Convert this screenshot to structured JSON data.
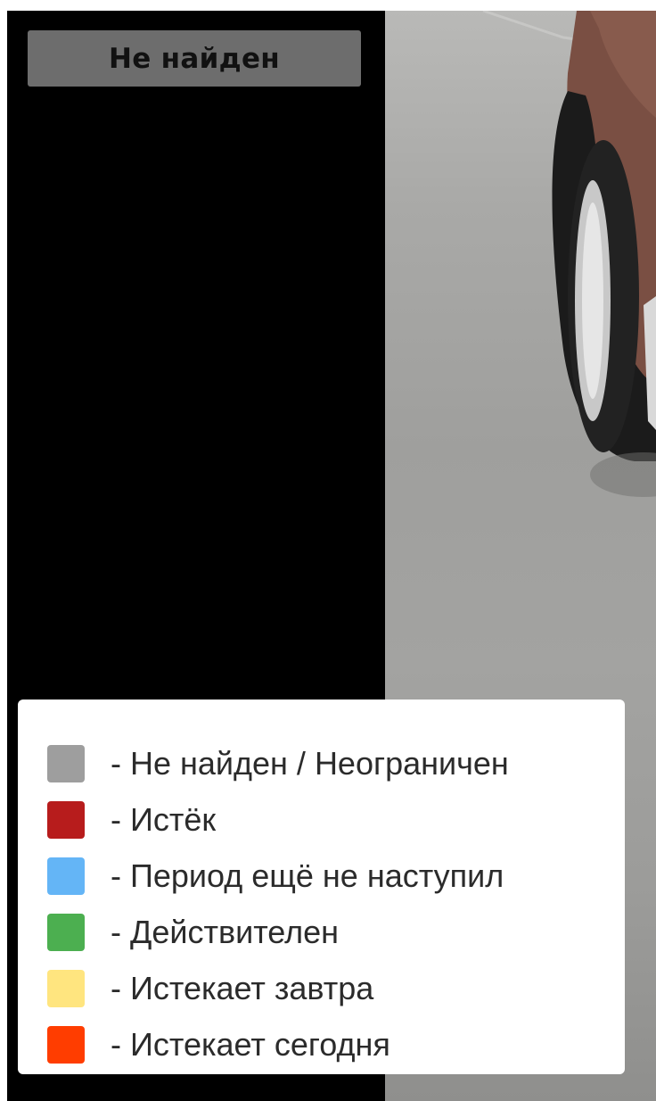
{
  "status": {
    "label": "Не найден",
    "color": "#6d6d6d"
  },
  "legend": {
    "items": [
      {
        "label": "- Не найден / Неограничен",
        "color": "#9e9e9e"
      },
      {
        "label": "- Истёк",
        "color": "#b71c1c"
      },
      {
        "label": "- Период ещё не наступил",
        "color": "#64b5f6"
      },
      {
        "label": "- Действителен",
        "color": "#4caf50"
      },
      {
        "label": "- Истекает завтра",
        "color": "#ffe57f"
      },
      {
        "label": "- Истекает сегодня",
        "color": "#ff3d00"
      }
    ]
  }
}
